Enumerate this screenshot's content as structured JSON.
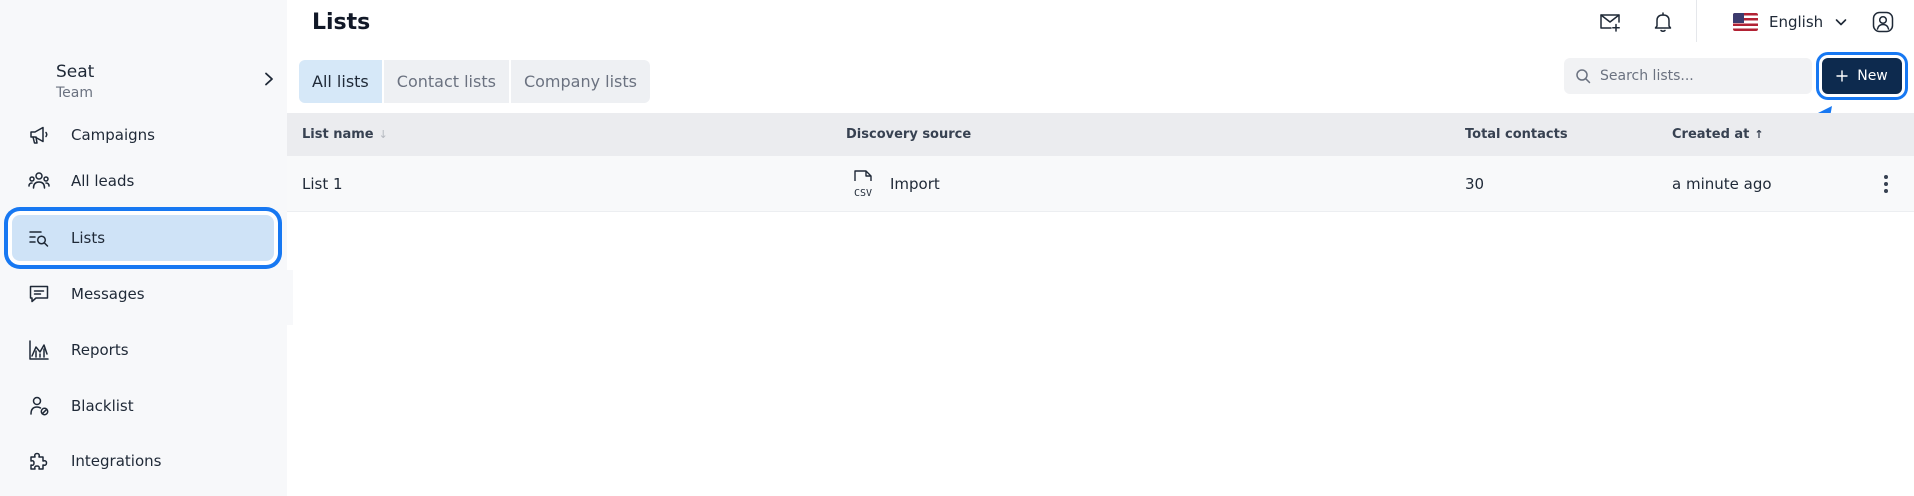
{
  "header": {
    "title": "Lists",
    "language": "English"
  },
  "team": {
    "name": "Seat",
    "subtitle": "Team"
  },
  "sidebar": {
    "items": [
      {
        "label": "Campaigns",
        "icon": "megaphone-icon"
      },
      {
        "label": "All leads",
        "icon": "users-icon"
      },
      {
        "label": "Lists",
        "icon": "list-search-icon",
        "active": true
      },
      {
        "label": "Messages",
        "icon": "message-icon"
      },
      {
        "label": "Reports",
        "icon": "chart-icon"
      },
      {
        "label": "Blacklist",
        "icon": "user-blocked-icon"
      },
      {
        "label": "Integrations",
        "icon": "puzzle-icon"
      }
    ]
  },
  "tabs": [
    {
      "label": "All lists",
      "active": true
    },
    {
      "label": "Contact lists",
      "active": false
    },
    {
      "label": "Company lists",
      "active": false
    }
  ],
  "search": {
    "placeholder": "Search lists...",
    "value": ""
  },
  "actions": {
    "new_label": "New"
  },
  "table": {
    "columns": [
      "List name",
      "Discovery source",
      "Total contacts",
      "Created at"
    ],
    "rows": [
      {
        "name": "List 1",
        "source": "Import",
        "source_icon": "csv-file-icon",
        "total": "30",
        "created": "a minute ago"
      }
    ]
  },
  "colors": {
    "accent": "#1778f2",
    "primary_button": "#0d2a4e",
    "active_nav": "#cfe3f7",
    "active_tab": "#d6e8f8"
  }
}
